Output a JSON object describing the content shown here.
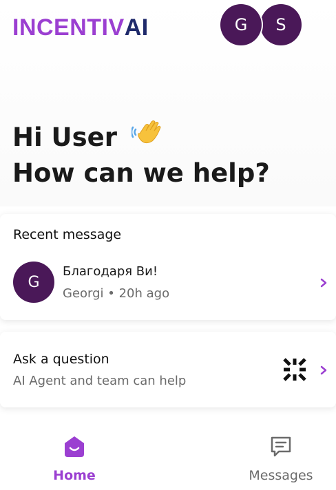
{
  "brand": {
    "logo_main": "INCENTIV",
    "logo_ai": "AI",
    "logo_color": "#9b3fd1",
    "logo_ai_color": "#1f2a6b"
  },
  "team_avatars": [
    {
      "initial": "G"
    },
    {
      "initial": "S"
    }
  ],
  "greeting": {
    "line1": "Hi User",
    "line2": "How can we help?",
    "emoji_icon": "waving-hand-icon"
  },
  "recent_message": {
    "section_title": "Recent message",
    "avatar_initial": "G",
    "text": "Благодаря Ви!",
    "meta": "Georgi • 20h ago"
  },
  "ask_question": {
    "title": "Ask a question",
    "subtitle": "AI Agent and team can help",
    "icon": "ai-agent-icon"
  },
  "bottom_nav": {
    "items": [
      {
        "label": "Home",
        "icon": "home-icon",
        "active": true
      },
      {
        "label": "Messages",
        "icon": "messages-icon",
        "active": false
      }
    ]
  },
  "colors": {
    "accent": "#9b3fd1",
    "avatar_bg": "#4a1858",
    "muted_text": "#6b6b6b"
  }
}
